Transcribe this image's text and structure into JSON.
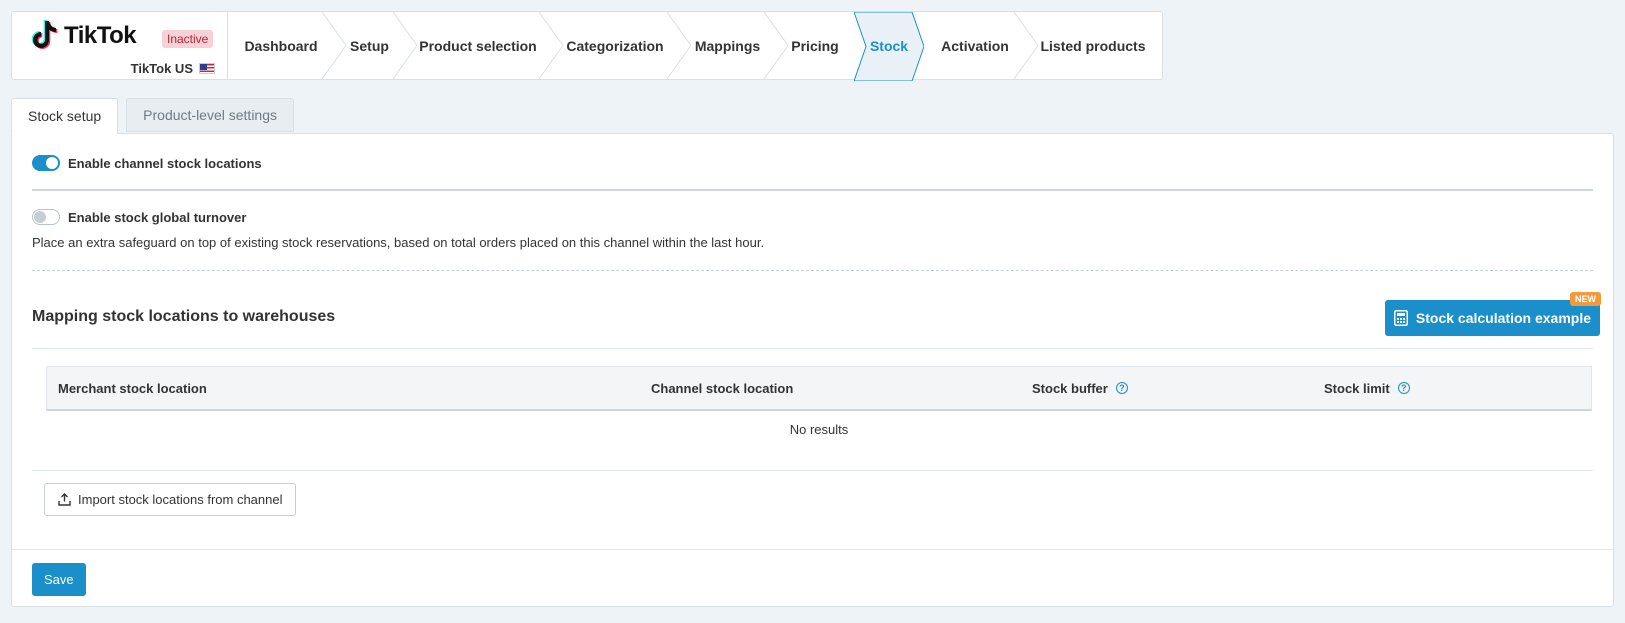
{
  "channel": {
    "logo_text": "TikTok",
    "status_badge": "Inactive",
    "name": "TikTok US"
  },
  "steps": [
    {
      "label": "Dashboard",
      "active": false
    },
    {
      "label": "Setup",
      "active": false
    },
    {
      "label": "Product selection",
      "active": false
    },
    {
      "label": "Categorization",
      "active": false
    },
    {
      "label": "Mappings",
      "active": false
    },
    {
      "label": "Pricing",
      "active": false
    },
    {
      "label": "Stock",
      "active": true
    },
    {
      "label": "Activation",
      "active": false
    },
    {
      "label": "Listed products",
      "active": false
    }
  ],
  "tabs": {
    "stock_setup": "Stock setup",
    "product_level": "Product-level settings"
  },
  "settings": {
    "channel_locations_label": "Enable channel stock locations",
    "channel_locations_enabled": true,
    "global_turnover_label": "Enable stock global turnover",
    "global_turnover_enabled": false,
    "global_turnover_desc": "Place an extra safeguard on top of existing stock reservations, based on total orders placed on this channel within the last hour."
  },
  "mapping": {
    "title": "Mapping stock locations to warehouses",
    "calc_button": "Stock calculation example",
    "new_badge": "NEW",
    "columns": {
      "merchant": "Merchant stock location",
      "channel": "Channel stock location",
      "buffer": "Stock buffer",
      "limit": "Stock limit"
    },
    "empty_text": "No results",
    "import_button": "Import stock locations from channel"
  },
  "footer": {
    "save_label": "Save"
  },
  "colors": {
    "accent": "#1a8fc9",
    "inactive_badge_bg": "#f6d1d6",
    "new_badge_bg": "#f39a3a"
  }
}
